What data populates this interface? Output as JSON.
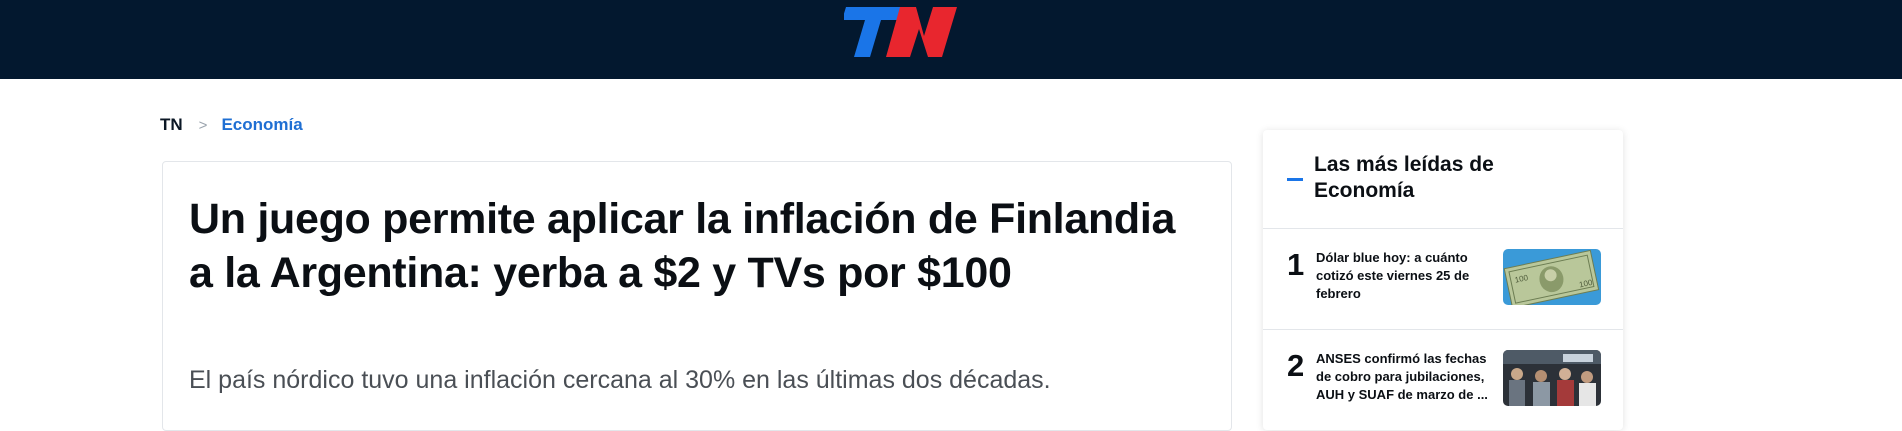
{
  "brand": {
    "logo_text": "TN",
    "colors": {
      "navy": "#03182f",
      "blue": "#1a75e8",
      "red": "#e8262e"
    }
  },
  "breadcrumb": {
    "home": "TN",
    "separator": ">",
    "section": "Economía"
  },
  "article": {
    "headline": "Un juego permite aplicar la inflación de Finlandia a la Argentina: yerba a $2 y TVs por $100",
    "subtitle": "El país nórdico tuvo una inflación cercana al 30% en las últimas dos décadas."
  },
  "most_read": {
    "title": "Las más leídas de Economía",
    "items": [
      {
        "rank": "1",
        "title": "Dólar blue hoy: a cuánto cotizó este viernes 25 de febrero",
        "thumb_icon": "banknotes-photo"
      },
      {
        "rank": "2",
        "title": "ANSES confirmó las fechas de cobro para jubilaciones, AUH y SUAF de marzo de ...",
        "thumb_icon": "people-queue-photo"
      }
    ]
  }
}
